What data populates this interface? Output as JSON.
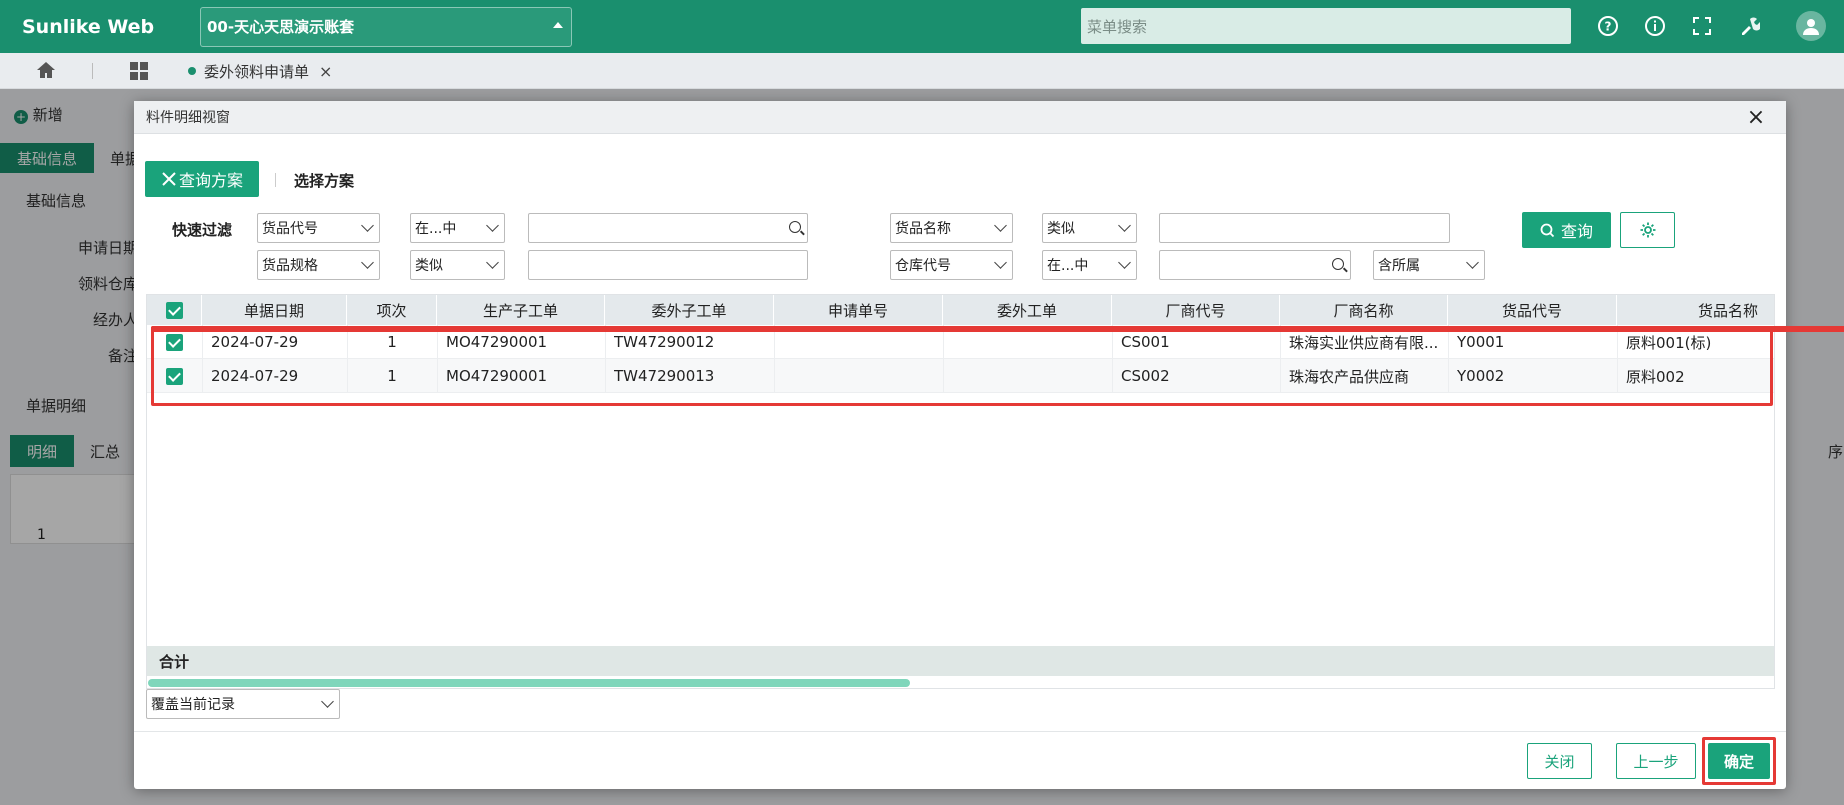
{
  "app": {
    "brand": "Sunlike Web",
    "account": "00-天心天思演示账套",
    "menu_search_placeholder": "菜单搜索",
    "top_icons": [
      "help-circle-icon",
      "info-icon",
      "fullscreen-icon",
      "tools-icon",
      "user-avatar-icon"
    ]
  },
  "tabs": {
    "home_icon": "home-icon",
    "grid_icon": "apps-icon",
    "open_tab": "委外领料申请单",
    "open_tab_close": "×"
  },
  "background_page": {
    "toolbar_add": "新增",
    "tab_basic": "基础信息",
    "tab_doc": "单据",
    "section_basic": "基础信息",
    "field_request_date": "申请日期",
    "field_warehouse": "领料仓库",
    "field_handler": "经办人",
    "field_note": "备注",
    "section_detail": "单据明细",
    "detail_tab_active": "明细",
    "detail_tab_summary": "汇总",
    "row_index": "1",
    "right_fragment": "序"
  },
  "modal": {
    "title": "料件明细视窗",
    "close": "×",
    "query_plan_button": "查询方案",
    "select_plan": "选择方案",
    "quick_filter": "快速过滤",
    "filters": [
      {
        "field": "货品代号",
        "op": "在...中",
        "value": ""
      },
      {
        "field": "货品名称",
        "op": "类似",
        "value": ""
      },
      {
        "field": "货品规格",
        "op": "类似",
        "value": ""
      },
      {
        "field": "仓库代号",
        "op": "在...中",
        "value": "",
        "extra": "含所属"
      }
    ],
    "search_button": "查询",
    "grid": {
      "columns": [
        "单据日期",
        "项次",
        "生产子工单",
        "委外子工单",
        "申请单号",
        "委外工单",
        "厂商代号",
        "厂商名称",
        "货品代号",
        "货品名称"
      ],
      "rows": [
        [
          "2024-07-29",
          "1",
          "MO47290001",
          "TW47290012",
          "",
          "",
          "CS001",
          "珠海实业供应商有限...",
          "Y0001",
          "原料001(标)"
        ],
        [
          "2024-07-29",
          "1",
          "MO47290001",
          "TW47290013",
          "",
          "",
          "CS002",
          "珠海农产品供应商",
          "Y0002",
          "原料002"
        ]
      ],
      "total_label": "合计"
    },
    "cover_mode": "覆盖当前记录",
    "footer": {
      "close": "关闭",
      "prev": "上一步",
      "confirm": "确定"
    }
  }
}
